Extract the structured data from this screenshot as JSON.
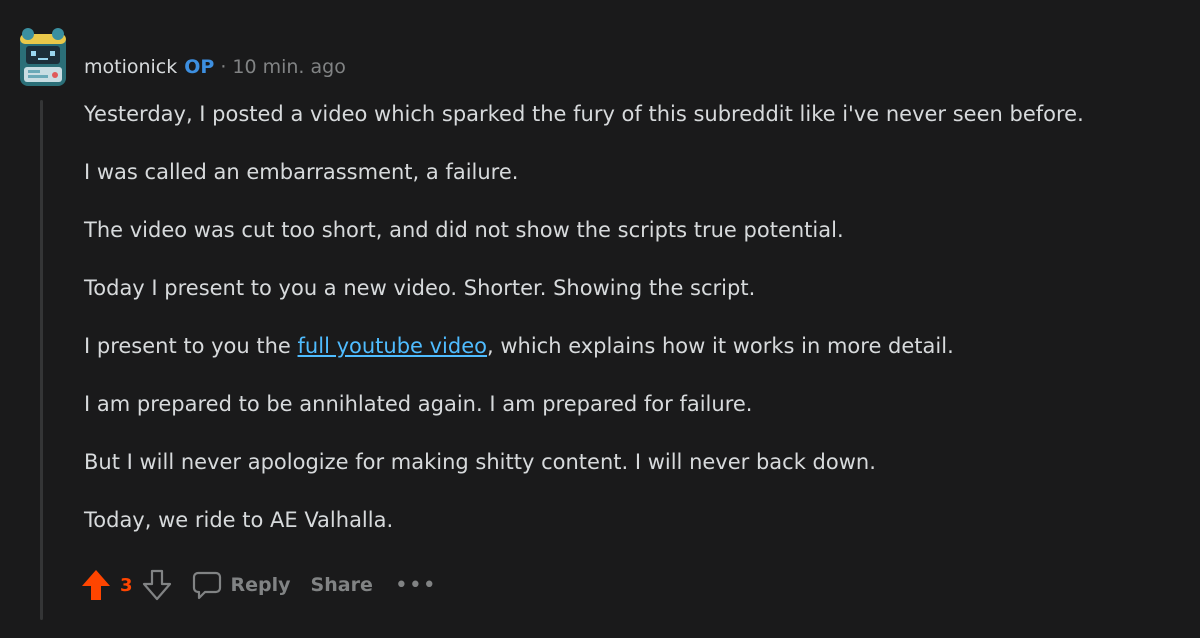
{
  "comment": {
    "author": "motionick",
    "op_badge": "OP",
    "separator": "·",
    "timestamp": "10 min. ago",
    "avatar_icon": "robot-avatar-icon",
    "paragraphs": [
      "Yesterday, I posted a video which sparked the fury of this subreddit like i've never seen before.",
      "I was called an embarrassment, a failure.",
      "The video was cut too short, and did not show the scripts true potential.",
      "Today I present to you a new video. Shorter. Showing the script.",
      {
        "before": "I present to you the ",
        "link": "full youtube video",
        "after": ", which explains how it works in more detail."
      },
      "I am prepared to be annihlated again. I am prepared for failure.",
      "But I will never apologize for making shitty content. I will never back down.",
      "Today, we ride to AE Valhalla."
    ],
    "score": "3",
    "reply_label": "Reply",
    "share_label": "Share",
    "more_label": "•••"
  },
  "colors": {
    "background": "#1a1a1b",
    "text": "#d7dadc",
    "muted": "#818384",
    "op_blue": "#3d8fe0",
    "upvote_orange": "#ff4500",
    "link": "#4fbcff"
  }
}
